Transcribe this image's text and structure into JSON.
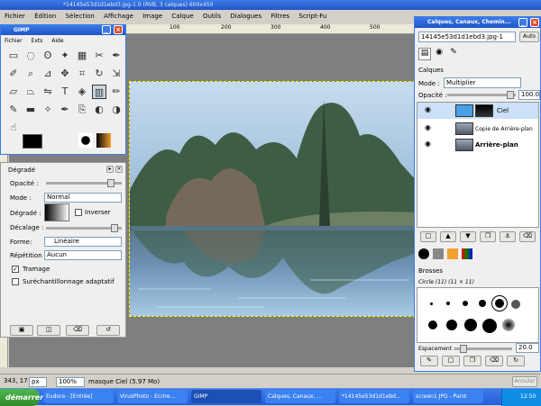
{
  "main_window": {
    "title": "*14145e53d1d1ebd3.jpg-1.0 (RVB, 3 calques) 600x450",
    "menu": [
      "Fichier",
      "Édition",
      "Sélection",
      "Affichage",
      "Image",
      "Calque",
      "Outils",
      "Dialogues",
      "Filtres",
      "Script-Fu"
    ],
    "ruler_ticks": [
      "100",
      "200",
      "300",
      "400",
      "500"
    ]
  },
  "toolbox": {
    "title": "GIMP",
    "menu": [
      "Fichier",
      "Exts",
      "Aide"
    ],
    "icons": [
      "rect-select-icon",
      "ellipse-select-icon",
      "lasso-icon",
      "magic-wand-icon",
      "select-by-color-icon",
      "scissors-icon",
      "paths-icon",
      "color-picker-icon",
      "zoom-icon",
      "measure-icon",
      "move-icon",
      "crop-icon",
      "rotate-icon",
      "scale-icon",
      "shear-icon",
      "perspective-icon",
      "flip-icon",
      "text-icon",
      "bucket-fill-icon",
      "blend-icon",
      "pencil-icon",
      "paintbrush-icon",
      "eraser-icon",
      "airbrush-icon",
      "ink-icon",
      "clone-icon",
      "convolve-icon",
      "dodge-burn-icon",
      "smudge-icon"
    ]
  },
  "tool_options": {
    "title": "Dégradé",
    "opacity_label": "Opacité :",
    "mode_label": "Mode :",
    "mode_value": "Normal",
    "gradient_label": "Dégradé :",
    "invert_label": "Inverser",
    "offset_label": "Décalage :",
    "shape_label": "Forme:",
    "shape_value": "Linéaire",
    "repeat_label": "Répétition :",
    "repeat_value": "Aucun",
    "dither_label": "Tramage",
    "dither_checked": true,
    "supersample_label": "Suréchantillonnage adaptatif",
    "supersample_checked": false
  },
  "status": {
    "coords": "343, 178",
    "unit": "px",
    "zoom": "100%",
    "message": "masque Ciel (5.97 Mo)",
    "cancel": "Annuler"
  },
  "layers_dock": {
    "title": "Calques, Canaux, Chemin...",
    "image_select": "14145e53d1d1ebd3.jpg-1",
    "auto_label": "Auto",
    "section": "Calques",
    "mode_label": "Mode :",
    "mode_value": "Multiplier",
    "opacity_label": "Opacité :",
    "opacity_value": "100.0",
    "layers": [
      {
        "name": "Ciel",
        "bold": false,
        "selected": true
      },
      {
        "name": "Copie de Arrière-plan",
        "bold": false,
        "selected": false
      },
      {
        "name": "Arrière-plan",
        "bold": true,
        "selected": false
      }
    ],
    "brushes_title": "Brosses",
    "brush_name": "Circle (11) (11 × 11)",
    "spacing_label": "Espacement :",
    "spacing_value": "20.0"
  },
  "taskbar": {
    "start": "démarrer",
    "items": [
      "Eudora - [Entrée]",
      "VirusPhoto - Ecrire...",
      "GIMP",
      "Calques, Canaux, ...",
      "*14145e53d1d1ebd...",
      "screen1 JPG - Paint"
    ],
    "clock": "12:50"
  },
  "colors": {
    "accent": "#3b7be8",
    "sky": "#c6dcee",
    "water": "#6f94b6"
  }
}
